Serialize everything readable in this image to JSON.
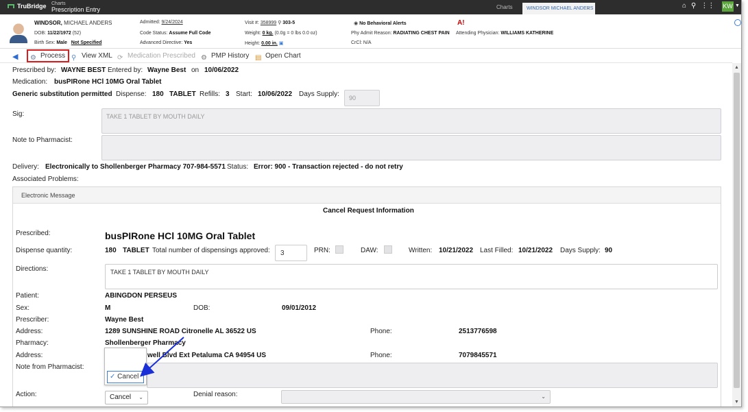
{
  "topbar": {
    "brand": "TruBridge",
    "crumb_small": "Charts",
    "crumb_title": "Prescription Entry",
    "tab_charts": "Charts",
    "tab_patient": "WINDSOR MICHAEL ANDERS",
    "tab_close": "×",
    "user_initials": "KW"
  },
  "patient": {
    "last_name": "WINDSOR,",
    "first_names": "MICHAEL ANDERS",
    "dob_label": "DOB:",
    "dob": "11/22/1972",
    "age": "(52)",
    "birth_sex_label": "Birth Sex:",
    "birth_sex": "Male",
    "birth_sex_extra": "Not Specified",
    "admitted_label": "Admitted:",
    "admitted": "9/24/2024",
    "code_status_label": "Code Status:",
    "code_status": "Assume Full Code",
    "adv_directive_label": "Advanced Directive:",
    "adv_directive": "Yes",
    "visit_label": "Visit #:",
    "visit": "358999",
    "room": "303-5",
    "weight_label": "Weight:",
    "weight": "0 kg.",
    "weight_detail": "(0.0g = 0 lbs 0.0 oz)",
    "height_label": "Height:",
    "height": "0.00 in.",
    "behavioral": "No Behavioral Alerts",
    "admit_reason_label": "Phy Admit Reason:",
    "admit_reason": "RADIATING CHEST PAIN",
    "crcl_label": "CrCl:",
    "crcl": "N/A",
    "attending_label": "Attending Physician:",
    "attending": "WILLIAMS KATHERINE"
  },
  "toolbar": {
    "process": "Process",
    "view_xml": "View XML",
    "medication_prescribed": "Medication Prescribed",
    "pmp_history": "PMP History",
    "open_chart": "Open Chart"
  },
  "rx": {
    "prescribed_by_label": "Prescribed by:",
    "prescribed_by": "WAYNE BEST",
    "entered_by_label": "Entered by:",
    "entered_by": "Wayne Best",
    "on_label": "on",
    "entered_on": "10/06/2022",
    "medication_label": "Medication:",
    "medication": "busPIRone HCl 10MG Oral Tablet",
    "generic": "Generic substitution permitted",
    "dispense_label": "Dispense:",
    "dispense": "180",
    "dispense_unit": "TABLET",
    "refills_label": "Refills:",
    "refills": "3",
    "start_label": "Start:",
    "start": "10/06/2022",
    "days_supply_label": "Days Supply:",
    "days_supply": "90",
    "sig_label": "Sig:",
    "sig": "TAKE 1 TABLET BY MOUTH DAILY",
    "note_label": "Note to Pharmacist:",
    "note": "",
    "delivery_label": "Delivery:",
    "delivery": "Electronically to Shollenberger Pharmacy 707-984-5571",
    "status_label": "Status:",
    "status": "Error: 900 - Transaction rejected - do not retry",
    "assoc_label": "Associated Problems:"
  },
  "em": {
    "section_title": "Electronic Message",
    "heading": "Cancel Request Information",
    "prescribed_label": "Prescribed:",
    "prescribed": "busPIRone HCl 10MG Oral Tablet",
    "dispense_qty_label": "Dispense quantity:",
    "dispense_qty": "180",
    "dispense_unit": "TABLET",
    "total_label": "Total number of dispensings approved:",
    "total": "3",
    "prn_label": "PRN:",
    "daw_label": "DAW:",
    "written_label": "Written:",
    "written": "10/21/2022",
    "last_filled_label": "Last Filled:",
    "last_filled": "10/21/2022",
    "days_supply_label": "Days Supply:",
    "days_supply": "90",
    "directions_label": "Directions:",
    "directions": "TAKE 1 TABLET BY MOUTH DAILY",
    "patient_label": "Patient:",
    "patient": "ABINGDON PERSEUS",
    "sex_label": "Sex:",
    "sex": "M",
    "dob_label": "DOB:",
    "dob": "09/01/2012",
    "prescriber_label": "Prescriber:",
    "prescriber": "Wayne Best",
    "address_label": "Address:",
    "address": "1289 SUNSHINE ROAD Citronelle AL 36522 US",
    "phone_label": "Phone:",
    "phone": "2513776598",
    "pharmacy_label": "Pharmacy:",
    "pharmacy": "Shollenberger Pharmacy",
    "pharmacy_address_label": "Address:",
    "pharmacy_address_visible": "well Blvd Ext Petaluma CA 94954 US",
    "pharmacy_phone_label": "Phone:",
    "pharmacy_phone": "7079845571",
    "note_from_label": "Note from Pharmacist:",
    "action_label": "Action:",
    "action_value": "Cancel",
    "dropdown_option": "Cancel",
    "denial_label": "Denial reason:"
  },
  "colors": {
    "highlight_box": "#d81e1e",
    "arrow": "#1a2fd6",
    "accent": "#3a7bd5"
  }
}
